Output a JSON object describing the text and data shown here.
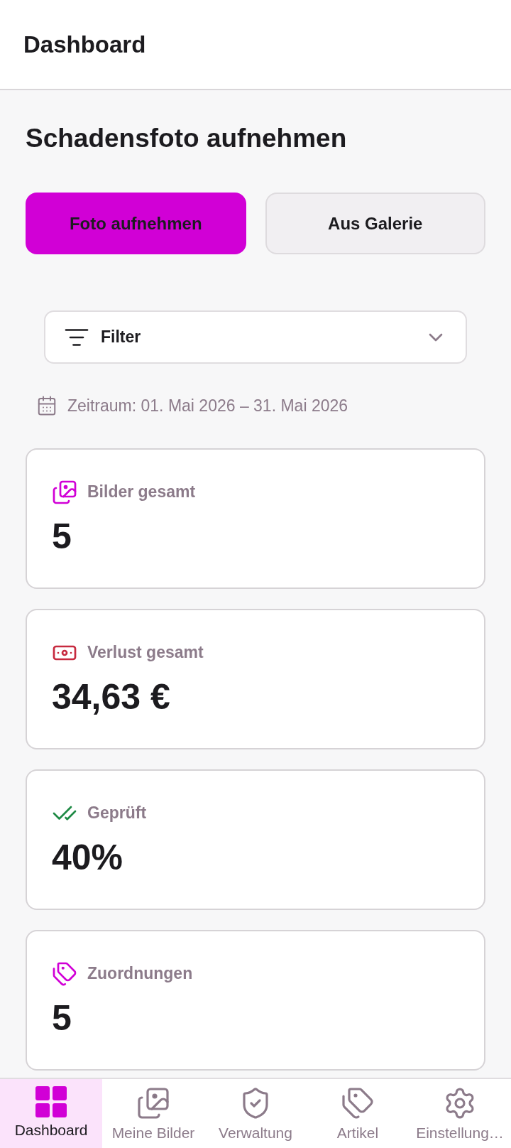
{
  "header": {
    "title": "Dashboard"
  },
  "section": {
    "title": "Schadensfoto aufnehmen"
  },
  "actions": [
    {
      "label": "Foto aufnehmen",
      "kind": "primary"
    },
    {
      "label": "Aus Galerie",
      "kind": "secondary"
    }
  ],
  "filter": {
    "label": "Filter",
    "expanded": false
  },
  "period": "Zeitraum: 01. Mai 2026 – 31. Mai 2026",
  "stats": [
    {
      "label": "Bilder gesamt",
      "value": "5",
      "kind": "images",
      "color": "#d100d6"
    },
    {
      "label": "Verlust gesamt",
      "value": "34,63 €",
      "kind": "money",
      "color": "#c72a3f"
    },
    {
      "label": "Geprüft",
      "value": "40%",
      "kind": "check",
      "color": "#1f8a45"
    },
    {
      "label": "Zuordnungen",
      "value": "5",
      "kind": "tag",
      "color": "#d100d6"
    }
  ],
  "nav": [
    {
      "label": "Dashboard",
      "kind": "grid",
      "selected": true
    },
    {
      "label": "Meine Bilder",
      "kind": "images",
      "selected": false
    },
    {
      "label": "Verwaltung",
      "kind": "shield",
      "selected": false
    },
    {
      "label": "Artikel",
      "kind": "tag",
      "selected": false
    },
    {
      "label": "Einstellung…",
      "kind": "gear",
      "selected": false
    }
  ]
}
